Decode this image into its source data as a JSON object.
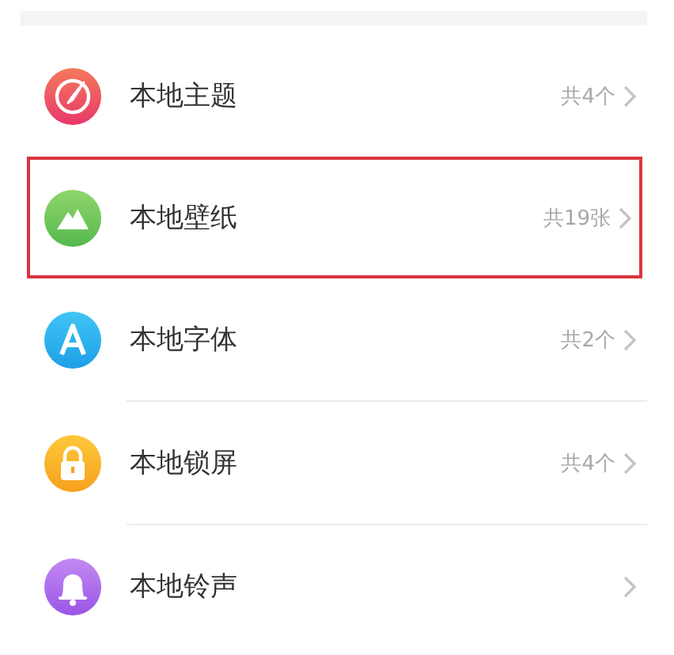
{
  "items": [
    {
      "kind": "theme",
      "label": "本地主题",
      "count": "共4个",
      "highlighted": false
    },
    {
      "kind": "wallpaper",
      "label": "本地壁纸",
      "count": "共19张",
      "highlighted": true
    },
    {
      "kind": "font",
      "label": "本地字体",
      "count": "共2个",
      "highlighted": false
    },
    {
      "kind": "lock",
      "label": "本地锁屏",
      "count": "共4个",
      "highlighted": false
    },
    {
      "kind": "ringtone",
      "label": "本地铃声",
      "highlighted": false
    }
  ]
}
